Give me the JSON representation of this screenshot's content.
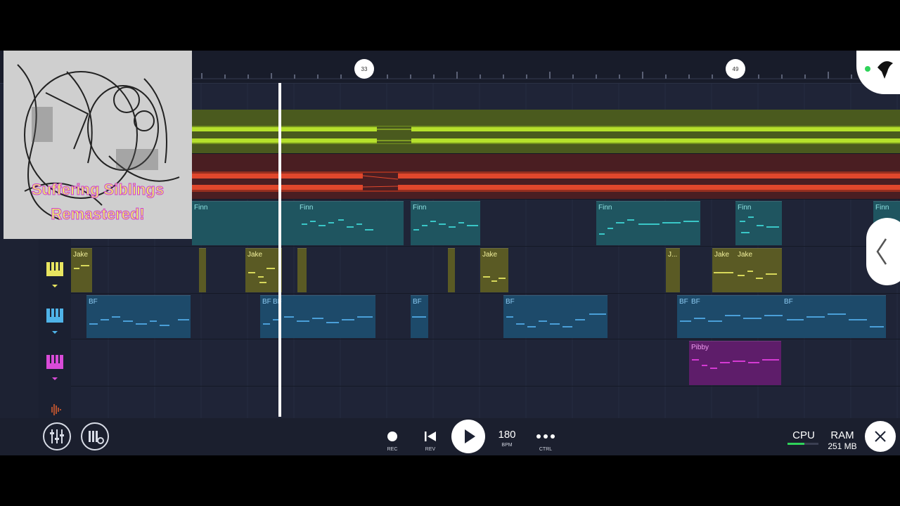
{
  "ruler": {
    "markers": [
      "33",
      "49"
    ]
  },
  "cover_art": {
    "title_lines": [
      "Suffering Siblings",
      "Remastered!"
    ]
  },
  "tracks": [
    {
      "clips": []
    },
    {
      "clips": []
    },
    {
      "clips": [
        {
          "label": "Finn"
        },
        {
          "label": "Finn"
        },
        {
          "label": "Finn"
        },
        {
          "label": "Finn"
        }
      ]
    },
    {
      "clips": [
        {
          "label": "Jake"
        },
        {
          "label": "Jake"
        },
        {
          "label": "Jake"
        },
        {
          "label": "J..."
        },
        {
          "label": "Jake"
        },
        {
          "label": "Jake"
        }
      ]
    },
    {
      "clips": [
        {
          "label": "BF"
        },
        {
          "label": "BF"
        },
        {
          "label": "BF"
        },
        {
          "label": "BF"
        },
        {
          "label": "BF"
        },
        {
          "label": "BF"
        },
        {
          "label": "BF"
        },
        {
          "label": "BF"
        },
        {
          "label": "BF"
        }
      ]
    },
    {
      "clips": [
        {
          "label": "Pibby"
        }
      ]
    }
  ],
  "transport": {
    "rec": "REC",
    "rev": "REV",
    "bpm_value": "180",
    "bpm": "BPM",
    "ctrl": "CTRL",
    "cpu": "CPU",
    "ram": "RAM",
    "ram_value": "251 MB"
  },
  "icons": {
    "mixer": "mixer-icon",
    "piano_settings": "piano-settings-icon",
    "record": "record-dot-icon",
    "rewind": "skip-back-icon",
    "play": "play-icon",
    "more": "more-dots-icon",
    "close": "close-icon",
    "collapse": "chevron-left-icon"
  },
  "colors": {
    "green_audio": "#b5e02b",
    "red_audio": "#e0472c",
    "finn": "#3ac7c7",
    "jake": "#d7d85a",
    "bf": "#4a9fd8",
    "pibby": "#d43ad3",
    "background": "#1d2233"
  }
}
